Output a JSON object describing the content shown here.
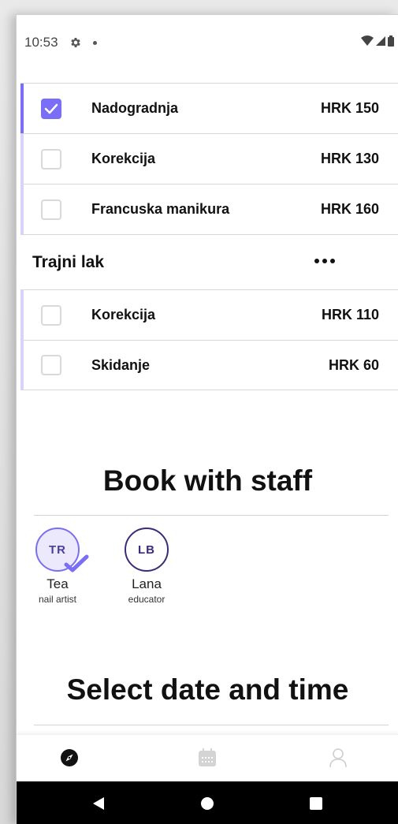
{
  "status_bar": {
    "time": "10:53",
    "icons": [
      "settings-icon",
      "notification-dot-icon",
      "wifi-icon",
      "signal-icon",
      "battery-icon"
    ]
  },
  "services_top": [
    {
      "name": "Nadogradnja",
      "price": "HRK 150",
      "checked": true
    },
    {
      "name": "Korekcija",
      "price": "HRK 130",
      "checked": false
    },
    {
      "name": "Francuska manikura",
      "price": "HRK 160",
      "checked": false
    }
  ],
  "category": {
    "title": "Trajni lak",
    "more_icon": "more-horizontal-icon"
  },
  "services_bottom": [
    {
      "name": "Korekcija",
      "price": "HRK 110",
      "checked": false
    },
    {
      "name": "Skidanje",
      "price": "HRK 60",
      "checked": false
    }
  ],
  "staff_section": {
    "title": "Book with staff",
    "staff": [
      {
        "initials": "TR",
        "name": "Tea",
        "role": "nail artist",
        "selected": true
      },
      {
        "initials": "LB",
        "name": "Lana",
        "role": "educator",
        "selected": false
      }
    ]
  },
  "datetime_section": {
    "title": "Select date and time"
  },
  "bottom_nav": {
    "items": [
      "explore-icon",
      "calendar-icon",
      "profile-icon"
    ],
    "active": "explore-icon"
  },
  "system_nav": {
    "items": [
      "back-icon",
      "home-icon",
      "recents-icon"
    ]
  },
  "colors": {
    "accent": "#7b6ef6",
    "accent_light": "#d7d3fb",
    "avatar_dark": "#3d2a78"
  }
}
